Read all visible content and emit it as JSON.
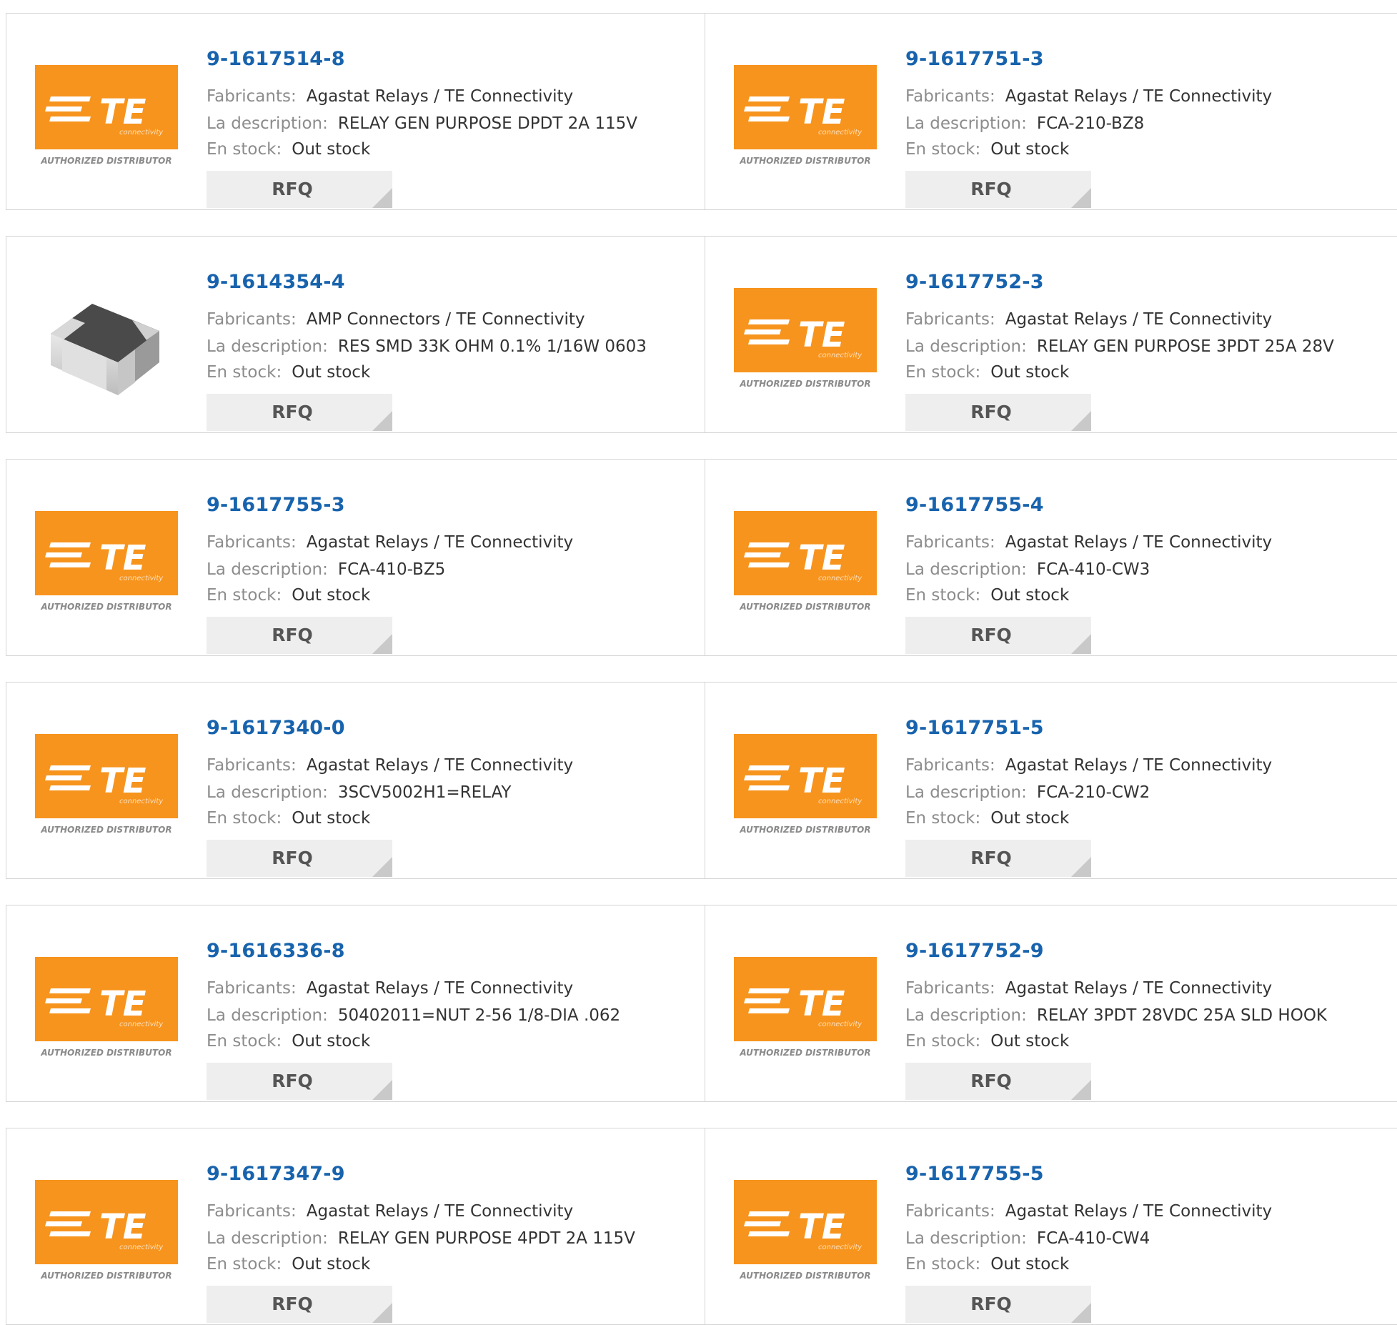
{
  "labels": {
    "manufacturer": "Fabricants:",
    "description": "La description:",
    "stock": "En stock:",
    "rfq": "RFQ"
  },
  "logo": {
    "brand": "TE",
    "tagline": "connectivity",
    "caption": "AUTHORIZED DISTRIBUTOR",
    "color": "#f7941d"
  },
  "products": [
    {
      "part": "9-1617514-8",
      "manufacturer": "Agastat Relays / TE Connectivity",
      "description": "RELAY GEN PURPOSE DPDT 2A 115V",
      "stock": "Out stock",
      "image": "te-logo"
    },
    {
      "part": "9-1617751-3",
      "manufacturer": "Agastat Relays / TE Connectivity",
      "description": "FCA-210-BZ8",
      "stock": "Out stock",
      "image": "te-logo"
    },
    {
      "part": "9-1614354-4",
      "manufacturer": "AMP Connectors / TE Connectivity",
      "description": "RES SMD 33K OHM 0.1% 1/16W 0603",
      "stock": "Out stock",
      "image": "resistor"
    },
    {
      "part": "9-1617752-3",
      "manufacturer": "Agastat Relays / TE Connectivity",
      "description": "RELAY GEN PURPOSE 3PDT 25A 28V",
      "stock": "Out stock",
      "image": "te-logo"
    },
    {
      "part": "9-1617755-3",
      "manufacturer": "Agastat Relays / TE Connectivity",
      "description": "FCA-410-BZ5",
      "stock": "Out stock",
      "image": "te-logo"
    },
    {
      "part": "9-1617755-4",
      "manufacturer": "Agastat Relays / TE Connectivity",
      "description": "FCA-410-CW3",
      "stock": "Out stock",
      "image": "te-logo"
    },
    {
      "part": "9-1617340-0",
      "manufacturer": "Agastat Relays / TE Connectivity",
      "description": "3SCV5002H1=RELAY",
      "stock": "Out stock",
      "image": "te-logo"
    },
    {
      "part": "9-1617751-5",
      "manufacturer": "Agastat Relays / TE Connectivity",
      "description": "FCA-210-CW2",
      "stock": "Out stock",
      "image": "te-logo"
    },
    {
      "part": "9-1616336-8",
      "manufacturer": "Agastat Relays / TE Connectivity",
      "description": "50402011=NUT 2-56 1/8-DIA .062",
      "stock": "Out stock",
      "image": "te-logo"
    },
    {
      "part": "9-1617752-9",
      "manufacturer": "Agastat Relays / TE Connectivity",
      "description": "RELAY 3PDT 28VDC 25A SLD HOOK",
      "stock": "Out stock",
      "image": "te-logo"
    },
    {
      "part": "9-1617347-9",
      "manufacturer": "Agastat Relays / TE Connectivity",
      "description": "RELAY GEN PURPOSE 4PDT 2A 115V",
      "stock": "Out stock",
      "image": "te-logo"
    },
    {
      "part": "9-1617755-5",
      "manufacturer": "Agastat Relays / TE Connectivity",
      "description": "FCA-410-CW4",
      "stock": "Out stock",
      "image": "te-logo"
    }
  ]
}
